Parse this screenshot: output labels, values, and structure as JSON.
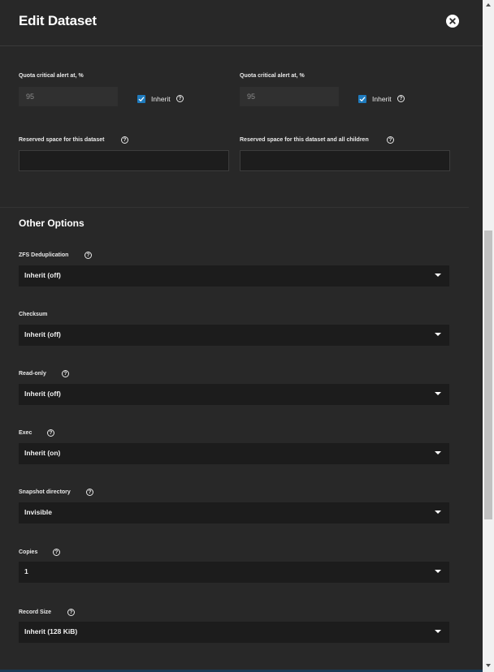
{
  "header": {
    "title": "Edit Dataset",
    "close_icon": "close-circle-icon"
  },
  "quota": {
    "left": {
      "label": "Quota critical alert at, %",
      "value": "95",
      "inherit_label": "Inherit",
      "inherit_checked": true
    },
    "right": {
      "label": "Quota critical alert at, %",
      "value": "95",
      "inherit_label": "Inherit",
      "inherit_checked": true
    }
  },
  "reserved": {
    "dataset_label": "Reserved space for this dataset",
    "dataset_value": "",
    "children_label": "Reserved space for this dataset and all children",
    "children_value": ""
  },
  "other_options": {
    "title": "Other Options",
    "fields": [
      {
        "label": "ZFS Deduplication",
        "value": "Inherit (off)",
        "help": true
      },
      {
        "label": "Checksum",
        "value": "Inherit (off)",
        "help": false
      },
      {
        "label": "Read-only",
        "value": "Inherit (off)",
        "help": true
      },
      {
        "label": "Exec",
        "value": "Inherit (on)",
        "help": true
      },
      {
        "label": "Snapshot directory",
        "value": "Invisible",
        "help": true
      },
      {
        "label": "Copies",
        "value": "1",
        "help": true
      },
      {
        "label": "Record Size",
        "value": "Inherit (128 KiB)",
        "help": true
      }
    ]
  },
  "help_glyph": "?",
  "colors": {
    "background": "#282828",
    "checkbox": "#1f7bbd",
    "select_bg": "#1c1c1c",
    "text": "#ffffff"
  }
}
